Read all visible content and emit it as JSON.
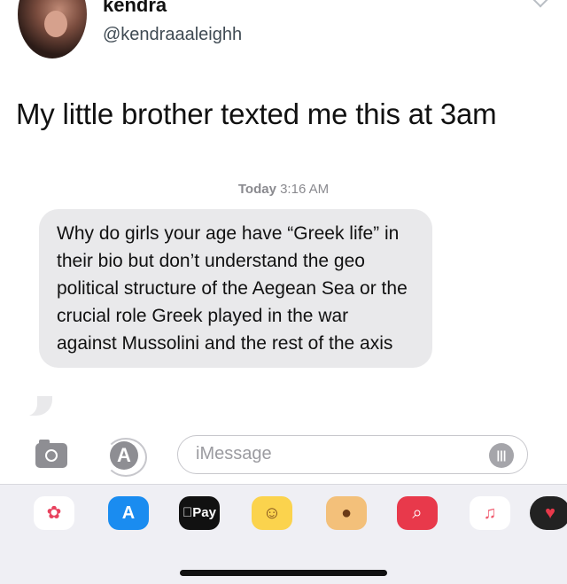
{
  "tweet": {
    "display_name": "kendra",
    "handle": "@kendraaaleighh",
    "text": "My little brother texted me this at 3am"
  },
  "messages": {
    "timestamp_day": "Today",
    "timestamp_time": "3:16 AM",
    "bubble_text": "Why do girls your age have “Greek life” in their bio but don’t understand the geo political structure of the Aegean Sea or the crucial role Greek played in the war against Mussolini and the rest of the axis"
  },
  "input_bar": {
    "placeholder": "iMessage"
  },
  "app_drawer": {
    "apps": [
      {
        "icon": "photos-icon",
        "glyph": "✿"
      },
      {
        "icon": "app-store-icon",
        "glyph": "A"
      },
      {
        "icon": "apple-pay-icon",
        "glyph": "Pay"
      },
      {
        "icon": "memoji-icon",
        "glyph": "☺"
      },
      {
        "icon": "monkey-animoji-icon",
        "glyph": "●"
      },
      {
        "icon": "image-search-icon",
        "glyph": "⌕"
      },
      {
        "icon": "music-icon",
        "glyph": "♫"
      },
      {
        "icon": "digital-touch-icon",
        "glyph": "♥"
      }
    ]
  },
  "colors": {
    "bubble_gray": "#e9e9eb",
    "app_store_blue": "#1a8cf0",
    "search_red": "#e8394b"
  }
}
